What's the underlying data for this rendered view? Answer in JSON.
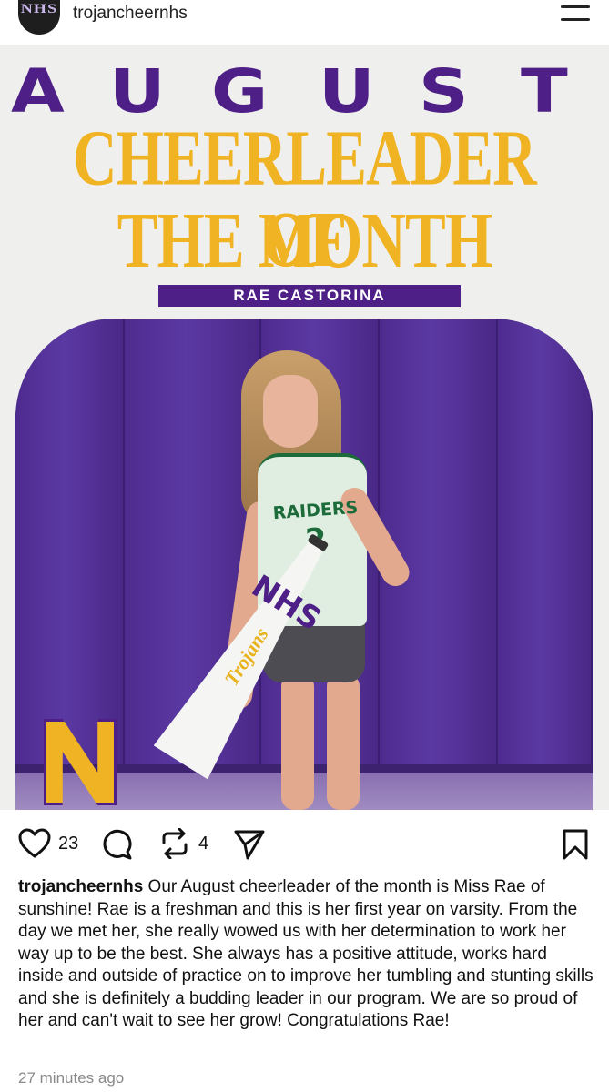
{
  "header": {
    "avatar_text": "NHS",
    "username": "trojancheernhs"
  },
  "post": {
    "month_letters": [
      "A",
      "U",
      "G",
      "U",
      "S",
      "T"
    ],
    "title_line1": "CHEERLEADER OF",
    "title_line2": "THE MONTH",
    "name": "RAE CASTORINA",
    "jersey_team": "RAIDERS",
    "jersey_number": "2",
    "megaphone_text": "Trojans",
    "megaphone_logo": "NHS",
    "colors": {
      "purple": "#4e1f86",
      "gold": "#f0b323"
    }
  },
  "actions": {
    "likes": "23",
    "reposts": "4",
    "icons": [
      "heart-icon",
      "comment-icon",
      "repost-icon",
      "share-icon",
      "bookmark-icon"
    ]
  },
  "caption": {
    "username": "trojancheernhs",
    "text": " Our August cheerleader of the month is Miss Rae of sunshine! Rae is a freshman and this is her first year on varsity. From the day we met her, she really wowed us with her determination to work her way up to be the best. She always has a positive attitude, works hard inside and outside of practice on to improve her tumbling and stunting skills and she is definitely a budding leader in our program. We are so proud of her and can't wait to see her grow! Congratulations Rae!"
  },
  "timestamp": "27 minutes ago"
}
